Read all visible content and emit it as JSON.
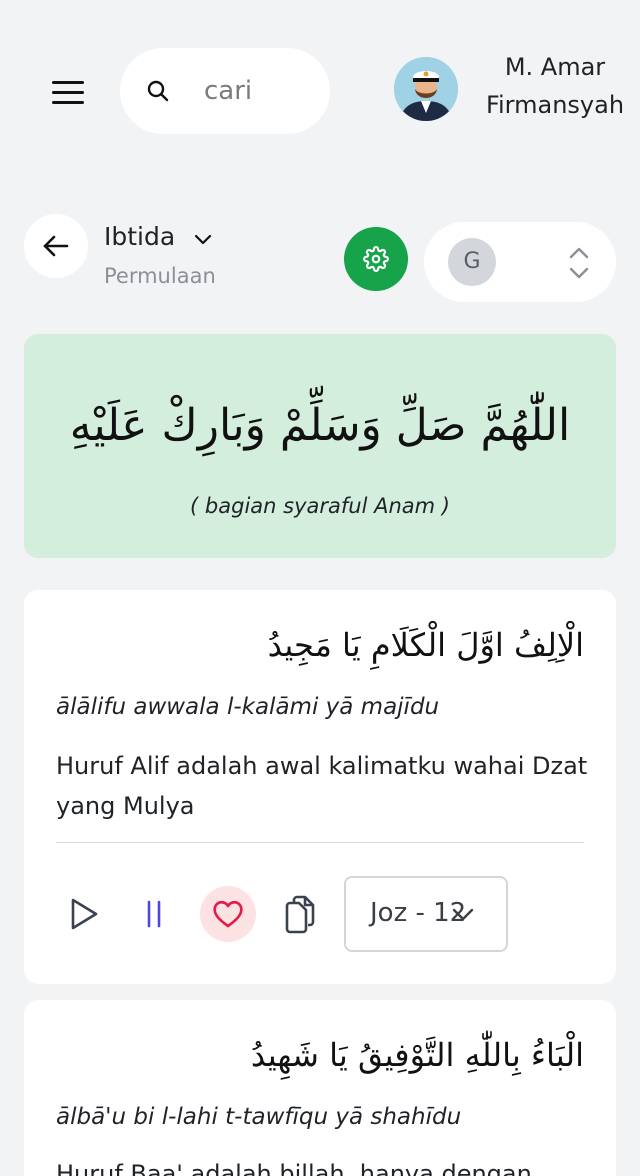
{
  "header": {
    "search": {
      "placeholder": "cari",
      "value": ""
    },
    "user": {
      "name_line1": "M. Amar",
      "name_line2": "Firmansyah"
    }
  },
  "section": {
    "title": "Ibtida",
    "subtitle": "Permulaan",
    "language_select": {
      "initial": "G"
    }
  },
  "banner": {
    "arabic": "اللّٰهُمَّ صَلِّ وَسَلِّمْ وَبَارِكْ عَلَيْهِ",
    "caption": "( bagian syaraful Anam )"
  },
  "verses": [
    {
      "arabic": "الْاِلِفُ اوَّلَ الْكَلَامِ يَا مَجِيدُ",
      "transliteration": "ālālifu awwala l-kalāmi yā majīdu",
      "translation": "Huruf Alif adalah awal kalimatku wahai Dzat yang Mulya",
      "juz_label": "Joz - 12"
    },
    {
      "arabic": "الْبَاءُ بِاللّٰهِ التَّوْفِيقُ يَا شَهِيدُ",
      "transliteration": "ālbā'u bi l-lahi t-tawfīqu yā shahīdu",
      "translation": "Huruf Baa' adalah billah, hanya dengan"
    }
  ],
  "colors": {
    "background": "#f2f3f5",
    "accent_green": "#16a34a",
    "banner_bg": "#d3eedd",
    "favorite_bg": "#fde2e4",
    "favorite_icon": "#e11d48",
    "pause_icon": "#4f46e5"
  }
}
